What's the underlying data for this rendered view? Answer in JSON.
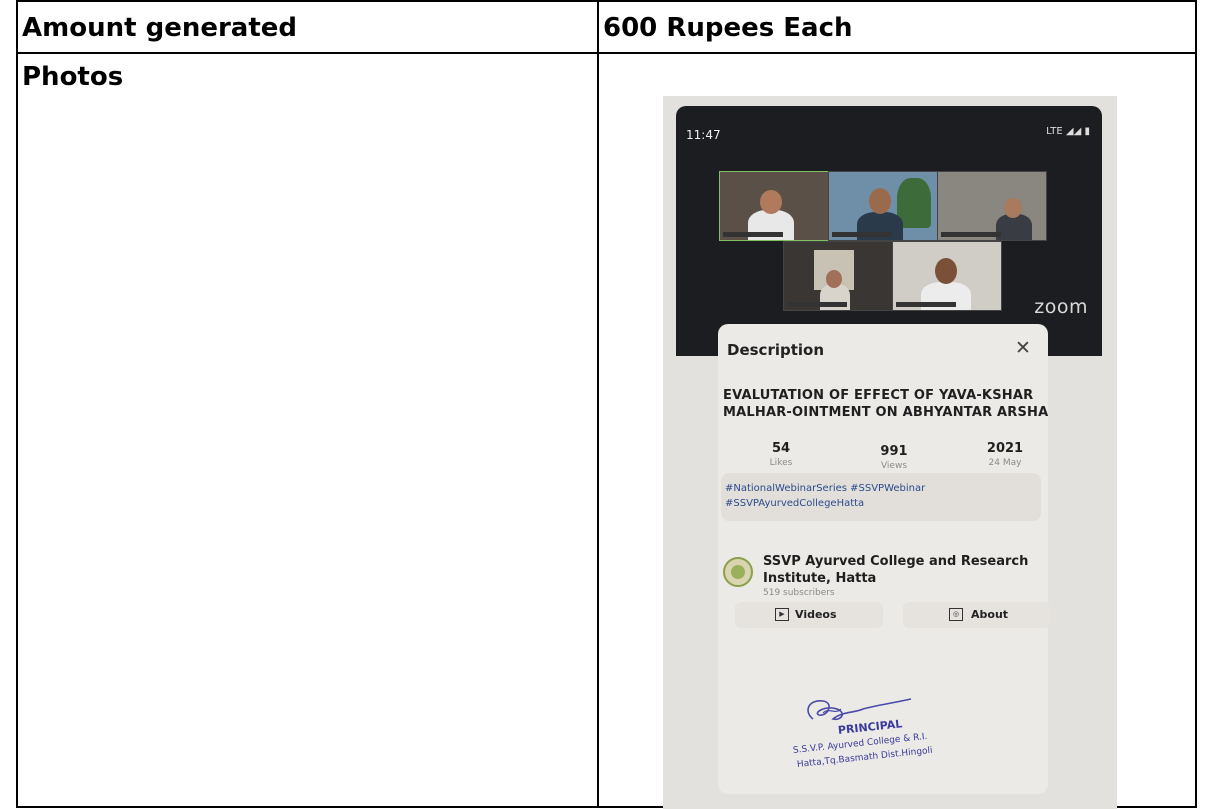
{
  "table": {
    "rows": [
      {
        "label": "Amount generated",
        "value": "600 Rupees Each"
      },
      {
        "label": "Photos"
      }
    ]
  },
  "photo": {
    "status_time": "11:47",
    "status_right": "LTE",
    "zoom_logo": "zoom",
    "panel_title": "Description",
    "video_title_lines": [
      "EVALUTATION OF EFFECT OF YAVA-KSHAR",
      "MALHAR-OINTMENT ON ABHYANTAR ARSHA"
    ],
    "stats": [
      {
        "value": "54",
        "label": "Likes"
      },
      {
        "value": "991",
        "label": "Views"
      },
      {
        "value": "2021",
        "label": "24 May"
      }
    ],
    "tags": [
      "#NationalWebinarSeries #SSVPWebinar",
      "#SSVPAyurvedCollegeHatta"
    ],
    "channel_name_lines": [
      "SSVP Ayurved College and Research",
      "Institute, Hatta"
    ],
    "subscribers": "519 subscribers",
    "buttons": {
      "videos": "Videos",
      "about": "About"
    },
    "stamp": {
      "title": "PRINCIPAL",
      "lines": [
        "S.S.V.P. Ayurved College & R.I.",
        "Hatta,Tq.Basmath Dist.Hingoli"
      ]
    }
  }
}
